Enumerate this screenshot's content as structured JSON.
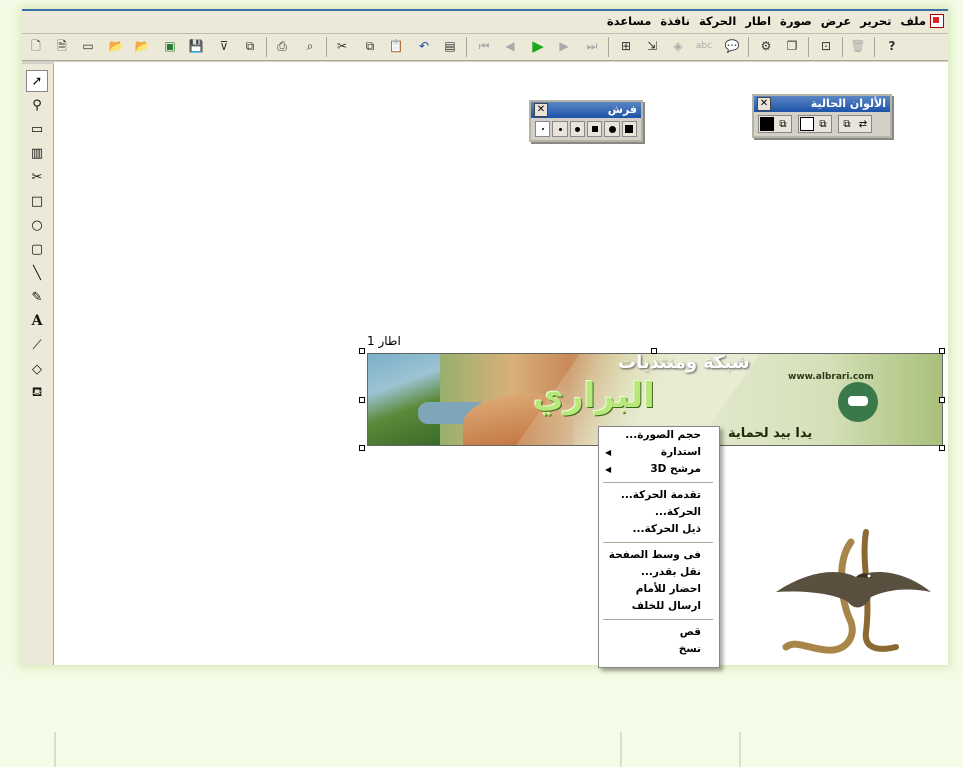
{
  "menubar": {
    "items": [
      "ملف",
      "تحرير",
      "عرض",
      "صورة",
      "اطار",
      "الحركة",
      "نافذة",
      "مساعدة"
    ]
  },
  "toolbar": {
    "icons": [
      "new-file-icon",
      "new-image-icon",
      "new-template-icon",
      "open-icon",
      "open-folder-icon",
      "import-icon",
      "save-icon",
      "filter-icon",
      "export-icon",
      "print-icon",
      "print-preview-icon",
      "cut-icon",
      "copy-icon",
      "paste-icon",
      "undo-icon",
      "properties-icon",
      "first-frame-icon",
      "prev-frame-icon",
      "play-icon",
      "next-frame-icon",
      "last-frame-icon",
      "crop-icon",
      "resize-icon",
      "3d-icon",
      "text-icon",
      "balloon-icon",
      "optimize-icon",
      "duplicate-icon",
      "transition-icon",
      "delete-icon",
      "help-icon"
    ]
  },
  "toolbox": {
    "tools": [
      "pointer-icon",
      "zoom-icon",
      "rect-select-icon",
      "gradient-icon",
      "scissors-icon",
      "rectangle-icon",
      "ellipse-icon",
      "rounded-rect-icon",
      "line-icon",
      "pencil-icon",
      "text-tool-icon",
      "eyedropper-icon",
      "eraser-icon",
      "fill-icon"
    ],
    "text_tool_glyph": "A"
  },
  "brush_palette": {
    "title": "فرش",
    "close": "✕"
  },
  "colors_palette": {
    "title": "الألوان الحالية",
    "close": "✕"
  },
  "canvas": {
    "frame_label": "اطار 1"
  },
  "banner": {
    "title": "شبكة ومنتديات",
    "brand": "البراري",
    "url": "www.albrari.com",
    "tagline": "يدا بيد لحماية"
  },
  "context_menu": {
    "items": [
      {
        "label": "حجم الصورة...",
        "submenu": false
      },
      {
        "label": "استدارة",
        "submenu": true
      },
      {
        "label": "مرشح 3D",
        "submenu": true
      },
      {
        "separator": true
      },
      {
        "label": "تقدمة الحركة...",
        "submenu": false
      },
      {
        "label": "الحركة...",
        "submenu": false
      },
      {
        "label": "ذيل الحركة...",
        "submenu": false
      },
      {
        "separator": true
      },
      {
        "label": "فى وسط الصفحة",
        "submenu": false
      },
      {
        "label": "نقل بقدر...",
        "submenu": false
      },
      {
        "label": "احضار للأمام",
        "submenu": false
      },
      {
        "label": "ارسال للخلف",
        "submenu": false
      },
      {
        "separator": true
      },
      {
        "label": "قص",
        "submenu": false
      },
      {
        "label": "نسخ",
        "submenu": false
      }
    ]
  },
  "colors": {
    "accent": "#3a6ea5",
    "play": "#1aa81a",
    "page_bg": "#f4fbe6"
  }
}
